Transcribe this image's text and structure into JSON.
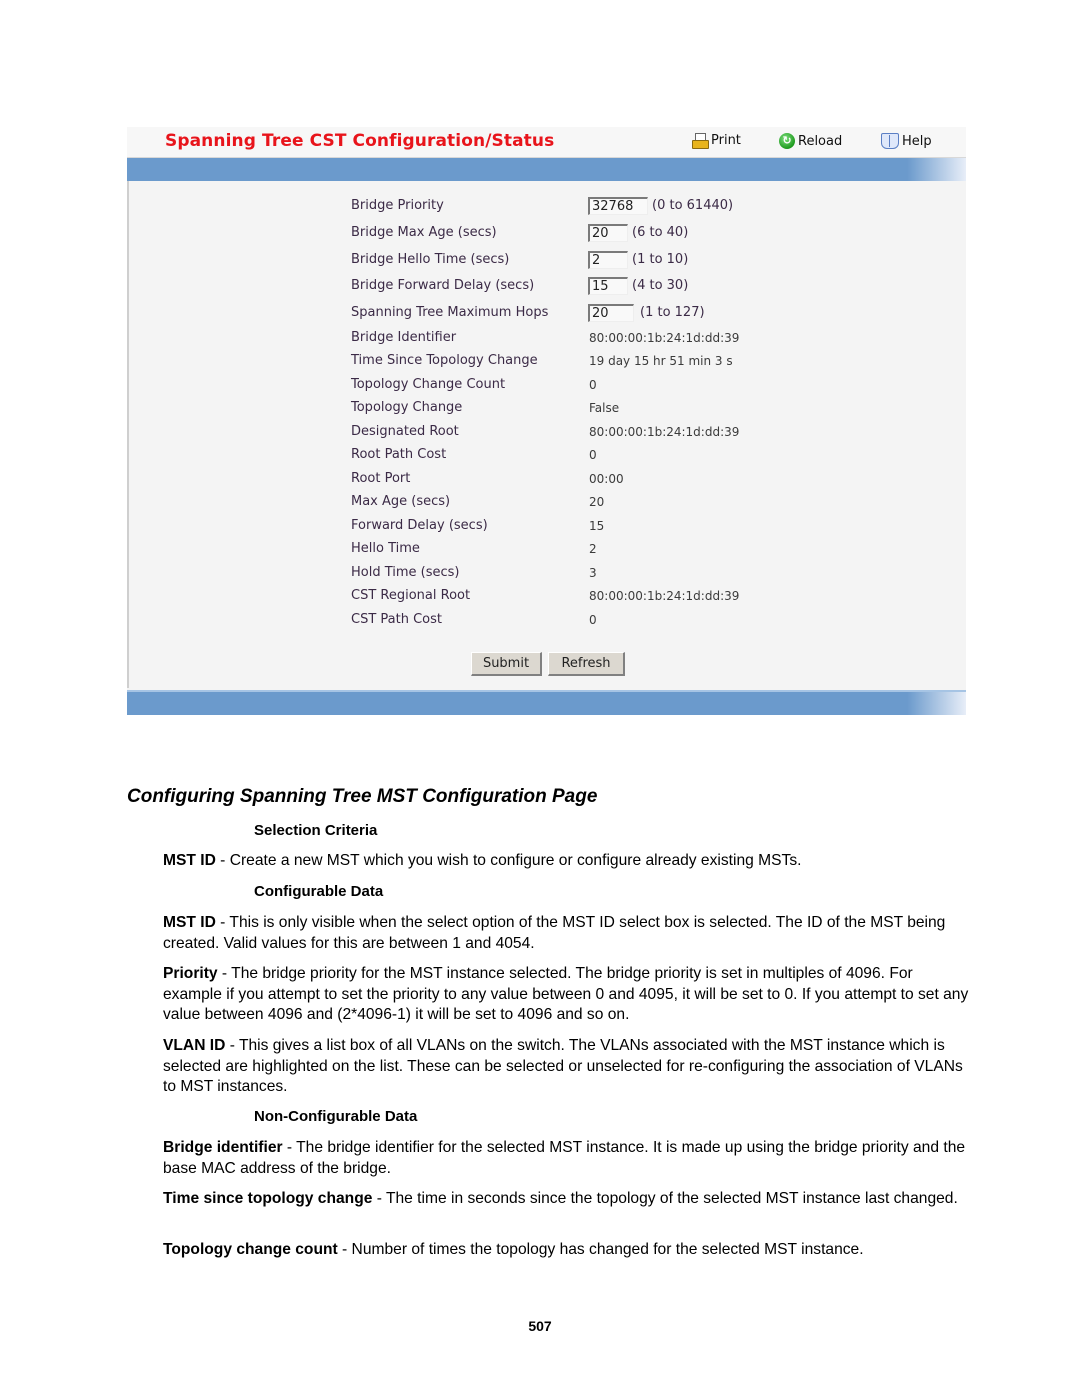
{
  "panel": {
    "title": "Spanning Tree CST Configuration/Status",
    "toolbar": [
      {
        "label": "Print",
        "icon": "printer-icon"
      },
      {
        "label": "Reload",
        "icon": "reload-icon"
      },
      {
        "label": "Help",
        "icon": "help-book-icon"
      }
    ],
    "inputs": [
      {
        "label": "Bridge Priority",
        "value": "32768",
        "range": "(0 to 61440)"
      },
      {
        "label": "Bridge Max Age (secs)",
        "value": "20",
        "range": "(6 to 40)"
      },
      {
        "label": "Bridge Hello Time (secs)",
        "value": "2",
        "range": "(1 to 10)"
      },
      {
        "label": "Bridge Forward Delay (secs)",
        "value": "15",
        "range": "(4 to 30)"
      },
      {
        "label": "Spanning Tree Maximum Hops",
        "value": "20",
        "range": "(1 to 127)"
      }
    ],
    "status": [
      {
        "label": "Bridge Identifier",
        "value": "80:00:00:1b:24:1d:dd:39"
      },
      {
        "label": "Time Since Topology Change",
        "value": "19 day 15 hr 51 min 3 s"
      },
      {
        "label": "Topology Change Count",
        "value": "0"
      },
      {
        "label": "Topology Change",
        "value": "False"
      },
      {
        "label": "Designated Root",
        "value": "80:00:00:1b:24:1d:dd:39"
      },
      {
        "label": "Root Path Cost",
        "value": "0"
      },
      {
        "label": "Root Port",
        "value": "00:00"
      },
      {
        "label": "Max Age (secs)",
        "value": "20"
      },
      {
        "label": "Forward Delay (secs)",
        "value": "15"
      },
      {
        "label": "Hello Time",
        "value": "2"
      },
      {
        "label": "Hold Time (secs)",
        "value": "3"
      },
      {
        "label": "CST Regional Root",
        "value": "80:00:00:1b:24:1d:dd:39"
      },
      {
        "label": "CST Path Cost",
        "value": "0"
      }
    ],
    "buttons": {
      "submit": "Submit",
      "refresh": "Refresh"
    }
  },
  "doc": {
    "heading": "Configuring Spanning Tree MST Configuration Page",
    "sections": {
      "selection_criteria": "Selection Criteria",
      "configurable_data": "Configurable Data",
      "non_configurable_data": "Non-Configurable Data"
    },
    "paragraphs": [
      {
        "term": "MST ID",
        "text": " - Create a new MST which you wish to configure or configure already existing MSTs."
      },
      {
        "term": "MST ID",
        "text": " - This is only visible when the select option of the MST ID select box is selected. The ID of the MST being created. Valid values for this are between 1 and 4054."
      },
      {
        "term": "Priority",
        "text": " - The bridge priority for the MST instance selected. The bridge priority is set in multiples of 4096. For example if you attempt to set the priority to any value between 0 and 4095, it will be set to 0. If you attempt to set any value between 4096 and (2*4096-1) it will be set to 4096 and so on."
      },
      {
        "term": "VLAN ID",
        "text": " - This gives a list box of all VLANs on the switch. The VLANs associated with the MST instance which is selected are highlighted on the list. These can be selected or unselected for re-configuring the association of VLANs to MST instances."
      },
      {
        "term": "Bridge identifier",
        "text": " - The bridge identifier for the selected MST instance. It is made up using the bridge priority and the base MAC address of the bridge."
      },
      {
        "term": "Time since topology change",
        "text": " - The time in seconds since the topology of the selected MST instance last changed."
      },
      {
        "term": "Topology change count",
        "text": " - Number of times the topology has changed for the selected MST instance."
      }
    ],
    "page_number": "507"
  }
}
